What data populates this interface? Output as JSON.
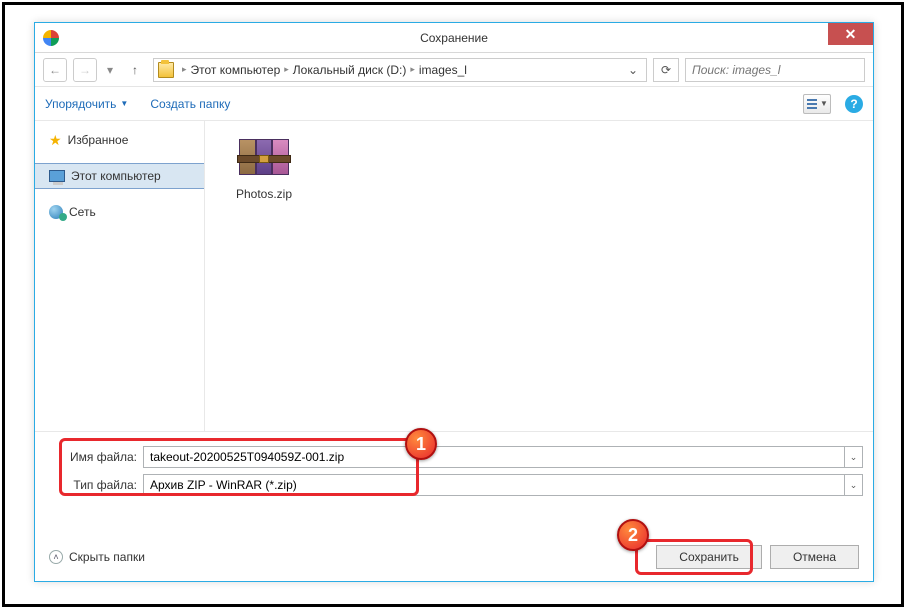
{
  "titlebar": {
    "title": "Сохранение"
  },
  "navbar": {
    "breadcrumbs": [
      "Этот компьютер",
      "Локальный диск (D:)",
      "images_l"
    ],
    "search_placeholder": "Поиск: images_l"
  },
  "toolbar": {
    "organize": "Упорядочить",
    "new_folder": "Создать папку"
  },
  "sidebar": {
    "favorites": "Избранное",
    "this_pc": "Этот компьютер",
    "network": "Сеть"
  },
  "filepane": {
    "items": [
      {
        "label": "Photos.zip"
      }
    ]
  },
  "bottom": {
    "filename_label": "Имя файла:",
    "filename_value": "takeout-20200525T094059Z-001.zip",
    "filetype_label": "Тип файла:",
    "filetype_value": "Архив ZIP - WinRAR (*.zip)",
    "hide_folders": "Скрыть папки",
    "save": "Сохранить",
    "cancel": "Отмена"
  },
  "annotations": {
    "badge1": "1",
    "badge2": "2"
  }
}
